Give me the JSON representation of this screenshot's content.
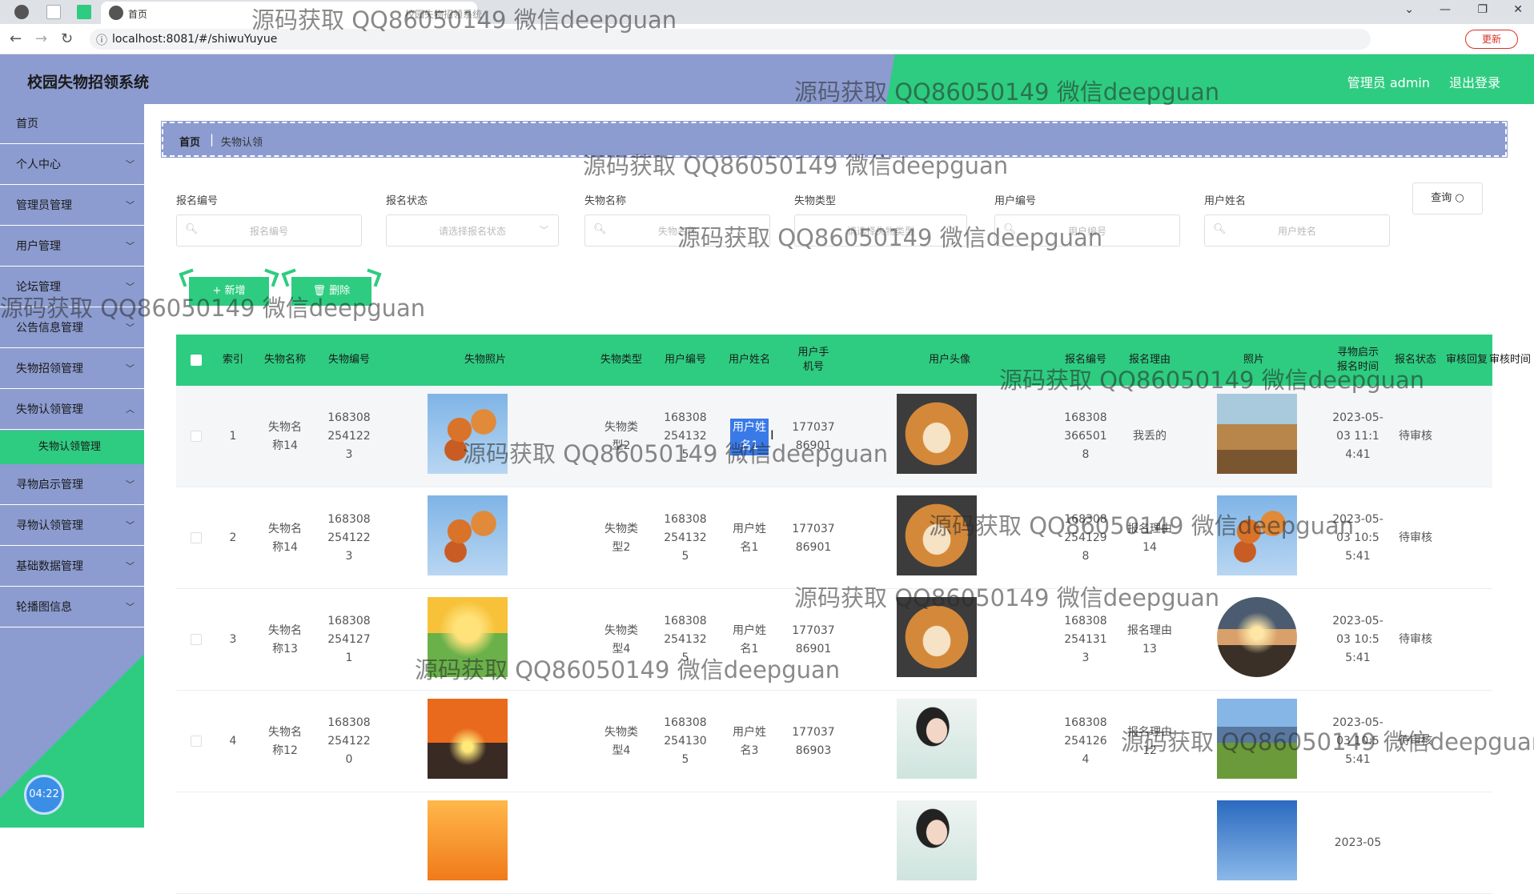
{
  "browser": {
    "tab_label": "首页",
    "tab2_label": "校园失物招领系统",
    "url": "localhost:8081/#/shiwuYuyue",
    "update_label": "更新"
  },
  "header": {
    "title": "校园失物招领系统",
    "user": "管理员 admin",
    "logout": "退出登录"
  },
  "sidebar": {
    "items": [
      {
        "label": "首页",
        "has_children": false
      },
      {
        "label": "个人中心",
        "has_children": true
      },
      {
        "label": "管理员管理",
        "has_children": true
      },
      {
        "label": "用户管理",
        "has_children": true
      },
      {
        "label": "论坛管理",
        "has_children": true
      },
      {
        "label": "公告信息管理",
        "has_children": true
      },
      {
        "label": "失物招领管理",
        "has_children": true
      },
      {
        "label": "失物认领管理",
        "has_children": true
      },
      {
        "label": "寻物启示管理",
        "has_children": true
      },
      {
        "label": "寻物认领管理",
        "has_children": true
      },
      {
        "label": "基础数据管理",
        "has_children": true
      },
      {
        "label": "轮播图信息",
        "has_children": true
      }
    ],
    "active_sub": "失物认领管理",
    "clock": "04:22"
  },
  "breadcrumb": {
    "home": "首页",
    "current": "失物认领"
  },
  "filters": [
    {
      "label": "报名编号",
      "placeholder": "报名编号",
      "type": "search"
    },
    {
      "label": "报名状态",
      "placeholder": "请选择报名状态",
      "type": "select"
    },
    {
      "label": "失物名称",
      "placeholder": "失物名称",
      "type": "search"
    },
    {
      "label": "失物类型",
      "placeholder": "请选择失物类型",
      "type": "select"
    },
    {
      "label": "用户编号",
      "placeholder": "用户编号",
      "type": "search"
    },
    {
      "label": "用户姓名",
      "placeholder": "用户姓名",
      "type": "search"
    }
  ],
  "query_label": "查询 ○",
  "actions": {
    "add": "+ 新增",
    "delete": "🗑 删除"
  },
  "table": {
    "headers": [
      "索引",
      "失物名称",
      "失物编号",
      "失物照片",
      "失物类型",
      "用户编号",
      "用户姓名",
      "用户手机号",
      "用户头像",
      "报名编号",
      "报名理由",
      "照片",
      "寻物启示报名时间",
      "报名状态",
      "审核回复",
      "审核时间"
    ],
    "rows": [
      {
        "idx": "1",
        "name": "失物名称14",
        "no": "1683082541223",
        "photo": "autumn",
        "type": "失物类型2",
        "user_no": "1683082541325",
        "user_name": "用户姓名1",
        "phone": "17703786901",
        "avatar": "dog",
        "apply_no": "1683083665018",
        "reason": "我丢的",
        "pic": "desert",
        "time": "2023-05-03 11:14:41",
        "status": "待审核"
      },
      {
        "idx": "2",
        "name": "失物名称14",
        "no": "1683082541223",
        "photo": "autumn",
        "type": "失物类型2",
        "user_no": "1683082541325",
        "user_name": "用户姓名1",
        "phone": "17703786901",
        "avatar": "dog",
        "apply_no": "1683082541298",
        "reason": "报名理由14",
        "pic": "autumn",
        "time": "2023-05-03 10:55:41",
        "status": "待审核"
      },
      {
        "idx": "3",
        "name": "失物名称13",
        "no": "1683082541271",
        "photo": "flower",
        "type": "失物类型4",
        "user_no": "1683082541325",
        "user_name": "用户姓名1",
        "phone": "17703786901",
        "avatar": "dog",
        "apply_no": "1683082541313",
        "reason": "报名理由13",
        "pic": "sunrise",
        "time": "2023-05-03 10:55:41",
        "status": "待审核"
      },
      {
        "idx": "4",
        "name": "失物名称12",
        "no": "1683082541220",
        "photo": "road",
        "type": "失物类型4",
        "user_no": "1683082541305",
        "user_name": "用户姓名3",
        "phone": "17703786903",
        "avatar": "woman",
        "apply_no": "1683082541264",
        "reason": "报名理由12",
        "pic": "mount",
        "time": "2023-05-03 10:55:41",
        "status": "待审核"
      },
      {
        "idx": "",
        "name": "",
        "no": "",
        "photo": "sunset",
        "type": "",
        "user_no": "",
        "user_name": "",
        "phone": "",
        "avatar": "woman",
        "apply_no": "",
        "reason": "",
        "pic": "sky",
        "time": "2023-05",
        "status": ""
      }
    ]
  },
  "watermark": "源码获取 QQ86050149 微信deepguan"
}
